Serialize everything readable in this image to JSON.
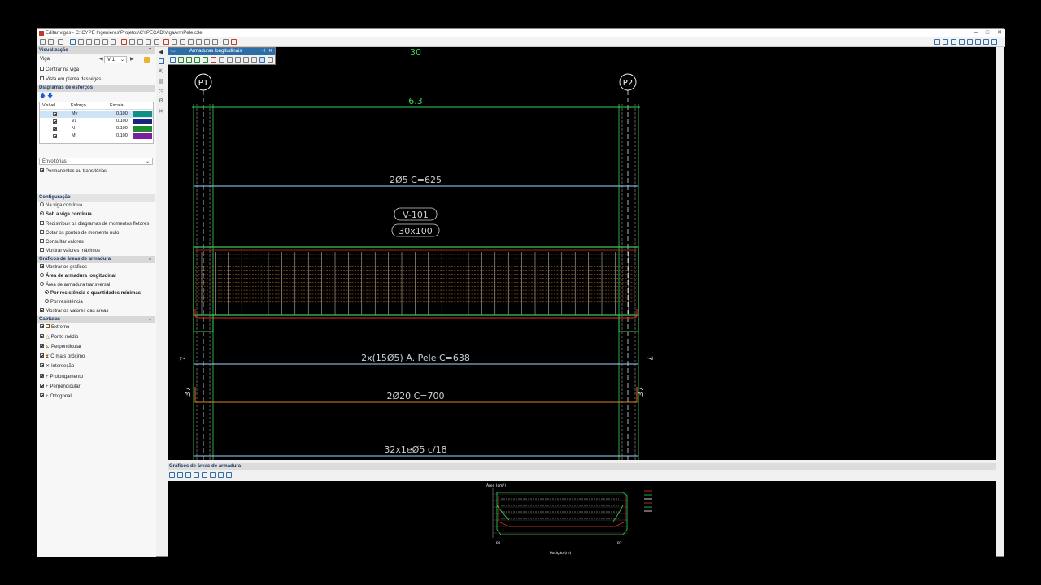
{
  "window": {
    "title": "Editar vigas - C:\\CYPE Ingenieros\\Projetos\\CYPECAD\\VigaArmPele.c3e"
  },
  "left_panel": {
    "visualizacao": {
      "header": "Visualização",
      "viga_label": "Viga",
      "viga_value": "V 1",
      "centrar": "Centrar na viga",
      "vista_planta": "Vista em planta das vigas"
    },
    "diagramas": {
      "header": "Diagramas de esforços",
      "columns": [
        "Visível",
        "Esforço",
        "Escala"
      ],
      "rows": [
        {
          "name": "My",
          "scale": "0.100",
          "color": "#0f8f86"
        },
        {
          "name": "Vz",
          "scale": "0.100",
          "color": "#1a237e"
        },
        {
          "name": "N",
          "scale": "0.100",
          "color": "#1f8a2e"
        },
        {
          "name": "Mt",
          "scale": "0.100",
          "color": "#7b1fa2"
        }
      ],
      "envolventes": "Envoltórias",
      "permanentes": "Permanentes ou transitórias"
    },
    "configuracao": {
      "header": "Configuração",
      "opt1": "Na viga contínua",
      "opt2": "Sob a viga contínua",
      "redistribuir": "Redistribuir os diagramas de momentos fletores",
      "cotar": "Cotar os pontos de momento nulo",
      "consultar": "Consultar valores",
      "mostrar_max": "Mostrar valores máximos"
    },
    "graficos": {
      "header": "Gráficos de áreas de armadura",
      "mostrar": "Mostrar os gráficos",
      "long": "Área de armadura longitudinal",
      "transv": "Área de armadura transversal",
      "por_res_q": "Por resistência e quantidades mínimas",
      "por_res": "Por resistência",
      "valores": "Mostrar os valores das áreas"
    },
    "capturas": {
      "header": "Capturas",
      "items": [
        "Extremo",
        "Ponto médio",
        "Perpendicular",
        "O mais próximo",
        "Interseção",
        "Prolongamento",
        "Perpendicular",
        "Ortogonal"
      ]
    }
  },
  "float_panel": {
    "title": "Armaduras longitudinais"
  },
  "drawing": {
    "top_dim": "30",
    "pillar_left": "P1",
    "pillar_right": "P2",
    "span": "6.3",
    "bar_top": "2Ø5  C=625",
    "beam_name": "V-101",
    "beam_section": "30x100",
    "bar_skin": "2x(15Ø5) A. Pele  C=638",
    "anchor_left": "37",
    "anchor_right": "37",
    "bar_bottom": "2Ø20  C=700",
    "stirrups": "32x1eØ5 c/18",
    "hook_left": "7",
    "hook_right": "7"
  },
  "bottom_panel": {
    "title": "Gráficos de áreas de armadura",
    "y_axis_label": "Área (cm²)",
    "x_axis_label": "Posição (m)",
    "x_start": "P1",
    "x_end": "P2"
  },
  "colors": {
    "green": "#39d353",
    "red": "#e0302a",
    "orange": "#d9822b",
    "cyan": "#9fd3ff",
    "white": "#ffffff"
  }
}
